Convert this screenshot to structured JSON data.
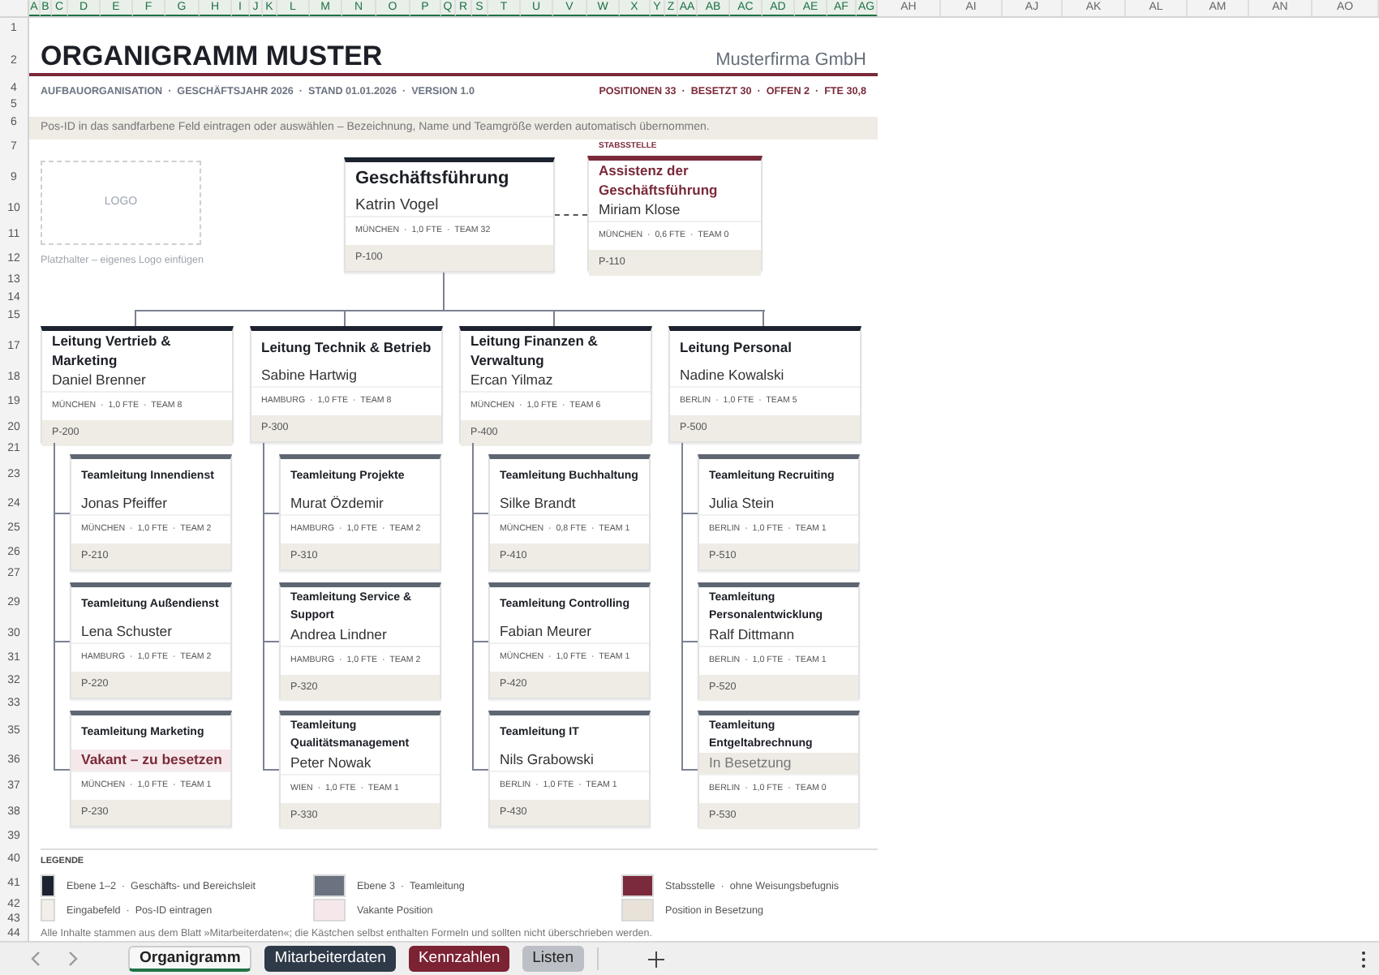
{
  "sheet": {
    "columns": [
      {
        "label": "A",
        "selected": true
      },
      {
        "label": "B",
        "selected": true
      },
      {
        "label": "C",
        "selected": true
      },
      {
        "label": "D",
        "selected": true
      },
      {
        "label": "E",
        "selected": true
      },
      {
        "label": "F",
        "selected": true
      },
      {
        "label": "G",
        "selected": true
      },
      {
        "label": "H",
        "selected": true
      },
      {
        "label": "I",
        "selected": true
      },
      {
        "label": "J",
        "selected": true
      },
      {
        "label": "K",
        "selected": true
      },
      {
        "label": "L",
        "selected": true
      },
      {
        "label": "M",
        "selected": true
      },
      {
        "label": "N",
        "selected": true
      },
      {
        "label": "O",
        "selected": true
      },
      {
        "label": "P",
        "selected": true
      },
      {
        "label": "Q",
        "selected": true
      },
      {
        "label": "R",
        "selected": true
      },
      {
        "label": "S",
        "selected": true
      },
      {
        "label": "T",
        "selected": true
      },
      {
        "label": "U",
        "selected": true
      },
      {
        "label": "V",
        "selected": true
      },
      {
        "label": "W",
        "selected": true
      },
      {
        "label": "X",
        "selected": true
      },
      {
        "label": "Y",
        "selected": true
      },
      {
        "label": "Z",
        "selected": true
      },
      {
        "label": "AA",
        "selected": true
      },
      {
        "label": "AB",
        "selected": true
      },
      {
        "label": "AC",
        "selected": true
      },
      {
        "label": "AD",
        "selected": true
      },
      {
        "label": "AE",
        "selected": true
      },
      {
        "label": "AF",
        "selected": true
      },
      {
        "label": "AG",
        "selected": true
      },
      {
        "label": "AH",
        "selected": false
      },
      {
        "label": "AI",
        "selected": false
      },
      {
        "label": "AJ",
        "selected": false
      },
      {
        "label": "AK",
        "selected": false
      },
      {
        "label": "AL",
        "selected": false
      },
      {
        "label": "AM",
        "selected": false
      },
      {
        "label": "AN",
        "selected": false
      },
      {
        "label": "AO",
        "selected": false
      }
    ],
    "rows": [
      "1",
      "2",
      "4",
      "5",
      "6",
      "7",
      "9",
      "10",
      "11",
      "12",
      "13",
      "14",
      "15",
      "17",
      "18",
      "19",
      "20",
      "21",
      "23",
      "24",
      "25",
      "26",
      "27",
      "29",
      "30",
      "31",
      "32",
      "33",
      "35",
      "36",
      "37",
      "38",
      "39",
      "40",
      "41",
      "42",
      "43",
      "44"
    ]
  },
  "header": {
    "title": "ORGANIGRAMM MUSTER",
    "company": "Musterfirma GmbH",
    "meta_left": "AUFBAUORGANISATION  ·  GESCHÄFTSJAHR 2026  ·  STAND 01.01.2026  ·  VERSION 1.0",
    "meta_right": "POSITIONEN 33  ·  BESETZT 30  ·  OFFEN 2  ·  FTE 30,8",
    "hint": "Pos-ID in das sandfarbene Feld eintragen oder auswählen – Bezeichnung, Name und Teamgröße werden automatisch übernommen."
  },
  "logo": {
    "label": "LOGO",
    "caption": "Platzhalter – eigenes Logo einfügen"
  },
  "management": {
    "kind": "executive",
    "title": "Geschäftsführung",
    "name": "Katrin Vogel",
    "vacant": false,
    "pending": false,
    "meta": "MÜNCHEN  ·  1,0 FTE  ·  TEAM 32",
    "pos_id": "P-100"
  },
  "staff_unit": {
    "tag": "STABSSTELLE",
    "card": {
      "kind": "staff",
      "title": "Assistenz der Geschäftsführung",
      "name": "Miriam Klose",
      "vacant": false,
      "pending": false,
      "meta": "MÜNCHEN  ·  0,6 FTE  ·  TEAM 0",
      "pos_id": "P-110"
    }
  },
  "departments": [
    {
      "head": {
        "kind": "department",
        "title": "Leitung Vertrieb & Marketing",
        "name": "Daniel Brenner",
        "vacant": false,
        "pending": false,
        "meta": "MÜNCHEN  ·  1,0 FTE  ·  TEAM 8",
        "pos_id": "P-200"
      },
      "teams": [
        {
          "kind": "team",
          "title": "Teamleitung Innendienst",
          "name": "Jonas Pfeiffer",
          "vacant": false,
          "pending": false,
          "meta": "MÜNCHEN  ·  1,0 FTE  ·  TEAM 2",
          "pos_id": "P-210"
        },
        {
          "kind": "team",
          "title": "Teamleitung Außendienst",
          "name": "Lena Schuster",
          "vacant": false,
          "pending": false,
          "meta": "HAMBURG  ·  1,0 FTE  ·  TEAM 2",
          "pos_id": "P-220"
        },
        {
          "kind": "team",
          "title": "Teamleitung Marketing",
          "name": "Vakant – zu besetzen",
          "vacant": true,
          "pending": false,
          "meta": "MÜNCHEN  ·  1,0 FTE  ·  TEAM 1",
          "pos_id": "P-230"
        }
      ]
    },
    {
      "head": {
        "kind": "department",
        "title": "Leitung Technik & Betrieb",
        "name": "Sabine Hartwig",
        "vacant": false,
        "pending": false,
        "meta": "HAMBURG  ·  1,0 FTE  ·  TEAM 8",
        "pos_id": "P-300"
      },
      "teams": [
        {
          "kind": "team",
          "title": "Teamleitung Projekte",
          "name": "Murat Özdemir",
          "vacant": false,
          "pending": false,
          "meta": "HAMBURG  ·  1,0 FTE  ·  TEAM 2",
          "pos_id": "P-310"
        },
        {
          "kind": "team",
          "title": "Teamleitung Service & Support",
          "name": "Andrea Lindner",
          "vacant": false,
          "pending": false,
          "meta": "HAMBURG  ·  1,0 FTE  ·  TEAM 2",
          "pos_id": "P-320"
        },
        {
          "kind": "team",
          "title": "Teamleitung Qualitätsmanagement",
          "name": "Peter Nowak",
          "vacant": false,
          "pending": false,
          "meta": "WIEN  ·  1,0 FTE  ·  TEAM 1",
          "pos_id": "P-330"
        }
      ]
    },
    {
      "head": {
        "kind": "department",
        "title": "Leitung Finanzen & Verwaltung",
        "name": "Ercan Yilmaz",
        "vacant": false,
        "pending": false,
        "meta": "MÜNCHEN  ·  1,0 FTE  ·  TEAM 6",
        "pos_id": "P-400"
      },
      "teams": [
        {
          "kind": "team",
          "title": "Teamleitung Buchhaltung",
          "name": "Silke Brandt",
          "vacant": false,
          "pending": false,
          "meta": "MÜNCHEN  ·  0,8 FTE  ·  TEAM 1",
          "pos_id": "P-410"
        },
        {
          "kind": "team",
          "title": "Teamleitung Controlling",
          "name": "Fabian Meurer",
          "vacant": false,
          "pending": false,
          "meta": "MÜNCHEN  ·  1,0 FTE  ·  TEAM 1",
          "pos_id": "P-420"
        },
        {
          "kind": "team",
          "title": "Teamleitung IT",
          "name": "Nils Grabowski",
          "vacant": false,
          "pending": false,
          "meta": "BERLIN  ·  1,0 FTE  ·  TEAM 1",
          "pos_id": "P-430"
        }
      ]
    },
    {
      "head": {
        "kind": "department",
        "title": "Leitung Personal",
        "name": "Nadine Kowalski",
        "vacant": false,
        "pending": false,
        "meta": "BERLIN  ·  1,0 FTE  ·  TEAM 5",
        "pos_id": "P-500"
      },
      "teams": [
        {
          "kind": "team",
          "title": "Teamleitung Recruiting",
          "name": "Julia Stein",
          "vacant": false,
          "pending": false,
          "meta": "BERLIN  ·  1,0 FTE  ·  TEAM 1",
          "pos_id": "P-510"
        },
        {
          "kind": "team",
          "title": "Teamleitung Personalentwicklung",
          "name": "Ralf Dittmann",
          "vacant": false,
          "pending": false,
          "meta": "BERLIN  ·  1,0 FTE  ·  TEAM 1",
          "pos_id": "P-520"
        },
        {
          "kind": "team",
          "title": "Teamleitung Entgeltabrechnung",
          "name": "In Besetzung",
          "vacant": false,
          "pending": true,
          "meta": "BERLIN  ·  1,0 FTE  ·  TEAM 0",
          "pos_id": "P-530"
        }
      ]
    }
  ],
  "legend": {
    "title": "LEGENDE",
    "items": [
      {
        "text": "Ebene 1–2  ·  Geschäfts- und Bereichsleit",
        "color": "#1c2230"
      },
      {
        "text": "Ebene 3  ·  Teamleitung",
        "color": "#6b7380"
      },
      {
        "text": "Stabsstelle  ·  ohne Weisungsbefugnis",
        "color": "#7a2a3a"
      },
      {
        "text": "Eingabefeld  ·  Pos-ID eintragen",
        "color": "#f2efe8"
      },
      {
        "text": "Vakante Position",
        "color": "#f6e8ea"
      },
      {
        "text": "Position in Besetzung",
        "color": "#e8e2d8"
      }
    ]
  },
  "note": "Alle Inhalte stammen aus dem Blatt »Mitarbeiterdaten«; die Kästchen selbst enthalten Formeln und sollten nicht überschrieben werden.",
  "sheet_tabs": [
    {
      "label": "Organigramm",
      "selected": true,
      "color": "#217346"
    },
    {
      "label": "Mitarbeiterdaten",
      "selected": false,
      "color": "#2f3a48"
    },
    {
      "label": "Kennzahlen",
      "selected": false,
      "color": "#7b2233"
    },
    {
      "label": "Listen",
      "selected": false,
      "color": "#bcc0c6"
    }
  ]
}
